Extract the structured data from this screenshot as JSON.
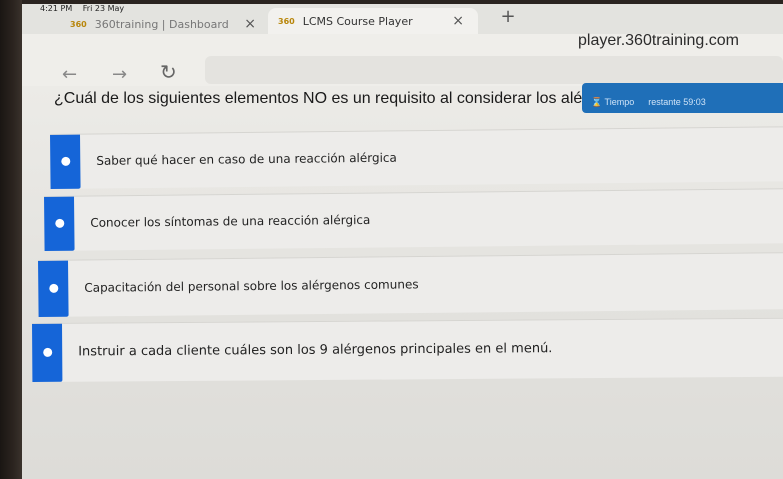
{
  "status_bar": {
    "time": "4:21 PM",
    "date": "Fri 23 May"
  },
  "tabs": [
    {
      "logo": "360",
      "label": "360training | Dashboard",
      "close": "×"
    },
    {
      "logo": "360",
      "label": "LCMS Course Player",
      "close": "×"
    }
  ],
  "new_tab": "+",
  "address": {
    "url": "player.360training.com"
  },
  "nav": {
    "back": "←",
    "forward": "→",
    "reload": "↻"
  },
  "question": {
    "text": "¿Cuál de los siguientes elementos NO es un requisito al considerar los alérgenos alimentar"
  },
  "timer": {
    "label": "⌛ Tiempo",
    "remaining": "restante 59:03"
  },
  "options": [
    "Saber qué hacer en caso de una reacción alérgica",
    "Conocer los síntomas de una reacción alérgica",
    "Capacitación del personal sobre los alérgenos comunes",
    "Instruir a cada cliente cuáles son los 9 alérgenos principales en el menú."
  ],
  "colors": {
    "accent": "#1565d8",
    "timer_bg": "#1f6fb8"
  }
}
